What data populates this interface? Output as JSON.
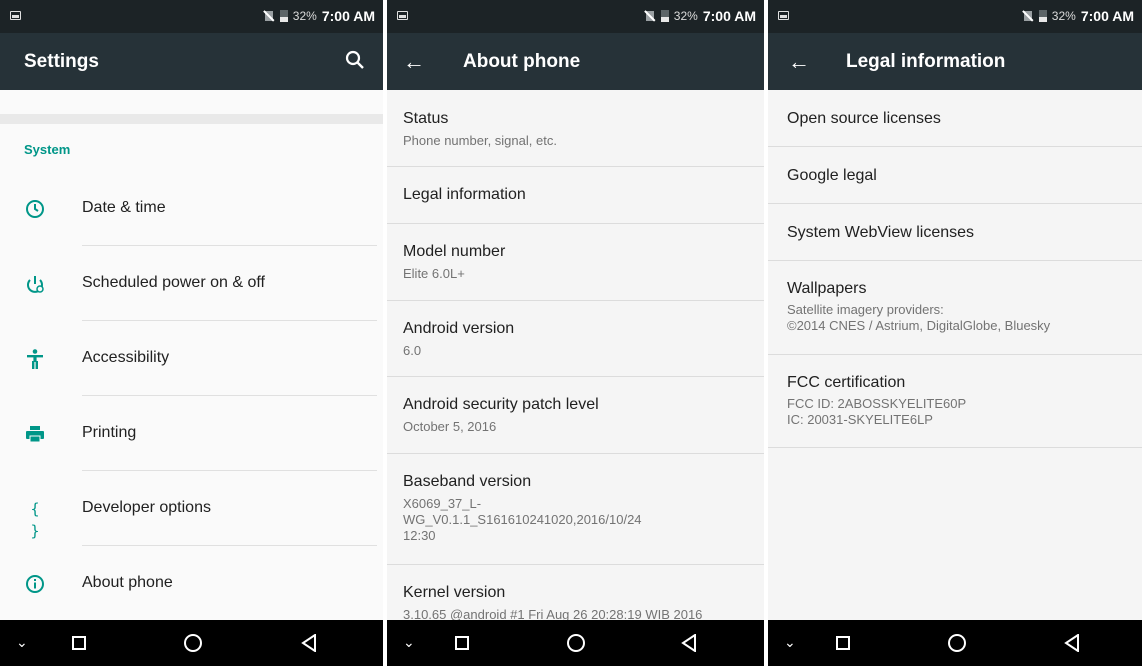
{
  "status_bar": {
    "battery_pct": "32%",
    "time": "7:00 AM"
  },
  "screen_settings": {
    "title": "Settings",
    "section": "System",
    "items": [
      {
        "label": "Date & time",
        "icon": "clock-icon"
      },
      {
        "label": "Scheduled power on & off",
        "icon": "power-schedule-icon"
      },
      {
        "label": "Accessibility",
        "icon": "accessibility-icon"
      },
      {
        "label": "Printing",
        "icon": "printer-icon"
      },
      {
        "label": "Developer options",
        "icon": "braces-icon"
      },
      {
        "label": "About phone",
        "icon": "info-icon"
      }
    ]
  },
  "screen_about": {
    "title": "About phone",
    "items": [
      {
        "title": "Status",
        "sub": "Phone number, signal, etc."
      },
      {
        "title": "Legal information",
        "sub": ""
      },
      {
        "title": "Model number",
        "sub": "Elite 6.0L+"
      },
      {
        "title": "Android version",
        "sub": "6.0"
      },
      {
        "title": "Android security patch level",
        "sub": "October 5, 2016"
      },
      {
        "title": "Baseband version",
        "sub1": "X6069_37_L-",
        "sub2": "WG_V0.1.1_S161610241020,2016/10/24",
        "sub3": "12:30"
      },
      {
        "title": "Kernel version",
        "sub": "3.10.65 @android #1 Fri Aug 26 20:28:19 WIB 2016"
      }
    ]
  },
  "screen_legal": {
    "title": "Legal information",
    "items": [
      {
        "title": "Open source licenses"
      },
      {
        "title": "Google legal"
      },
      {
        "title": "System WebView licenses"
      },
      {
        "title": "Wallpapers",
        "sub1": "Satellite imagery providers:",
        "sub2": "©2014 CNES / Astrium, DigitalGlobe, Bluesky"
      },
      {
        "title": "FCC certification",
        "sub1": "FCC ID: 2ABOSSKYELITE60P",
        "sub2": "IC: 20031-SKYELITE6LP"
      }
    ]
  },
  "colors": {
    "accent": "#009688",
    "appbar": "#263238",
    "statusbar": "#1c2326"
  }
}
